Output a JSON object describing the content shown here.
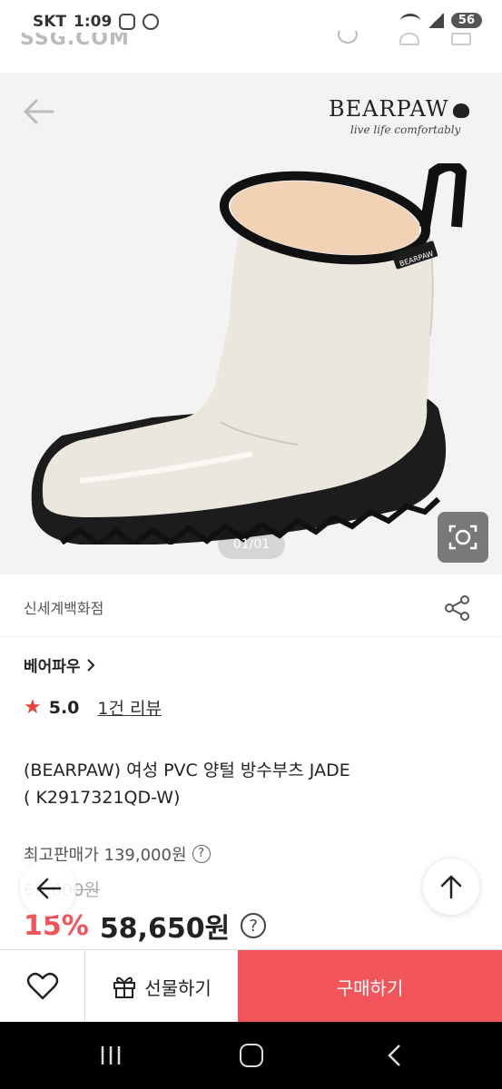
{
  "status_bar": {
    "carrier": "SKT",
    "time": "1:09",
    "battery": "56"
  },
  "ghost_header": {
    "text": "SSG.COM"
  },
  "product_image": {
    "brand_name": "BEARPAW",
    "brand_tagline": "live life comfortably",
    "boot_label": "BEARPAW",
    "page_indicator": "01/01"
  },
  "store": {
    "name": "신세계백화점"
  },
  "brand": {
    "link_label": "베어파우"
  },
  "rating": {
    "value": "5.0",
    "review_link": "1건 리뷰"
  },
  "product": {
    "title_line1": "(BEARPAW) 여성 PVC 양털 방수부츠 JADE",
    "title_line2": "( K2917321QD-W)"
  },
  "price": {
    "max_price_label": "최고판매가 139,000원",
    "original_price": "69,000원",
    "discount": "15%",
    "sale_price": "58,650원",
    "help_symbol": "?"
  },
  "actions": {
    "gift_label": "선물하기",
    "buy_label": "구매하기"
  },
  "colors": {
    "accent": "#f2545b",
    "star": "#e8423f"
  }
}
